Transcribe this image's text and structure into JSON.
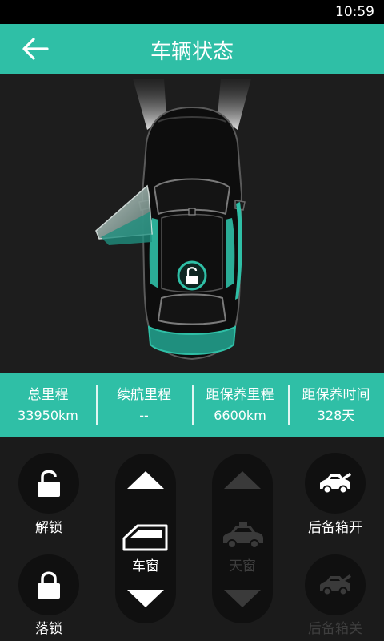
{
  "status_bar": {
    "time": "10:59"
  },
  "header": {
    "title": "车辆状态"
  },
  "colors": {
    "accent": "#2fbfa6",
    "background": "#1c1c1c",
    "button_bg": "#101010",
    "disabled": "#3a3a3a"
  },
  "icons": {
    "back": "arrow-left-icon",
    "lock_status": "unlocked-padlock-icon",
    "unlock": "unlocked-padlock-icon",
    "lock": "locked-padlock-icon",
    "window": "car-window-icon",
    "sunroof": "car-icon",
    "trunk_open": "car-trunk-open-icon",
    "trunk_close": "car-trunk-close-icon"
  },
  "stats": [
    {
      "label": "总里程",
      "value": "33950km"
    },
    {
      "label": "续航里程",
      "value": "--"
    },
    {
      "label": "距保养里程",
      "value": "6600km"
    },
    {
      "label": "距保养时间",
      "value": "328天"
    }
  ],
  "controls": {
    "unlock_label": "解锁",
    "lock_label": "落锁",
    "window_label": "车窗",
    "sunroof_label": "天窗",
    "trunk_open_label": "后备箱开",
    "trunk_close_label": "后备箱关"
  }
}
